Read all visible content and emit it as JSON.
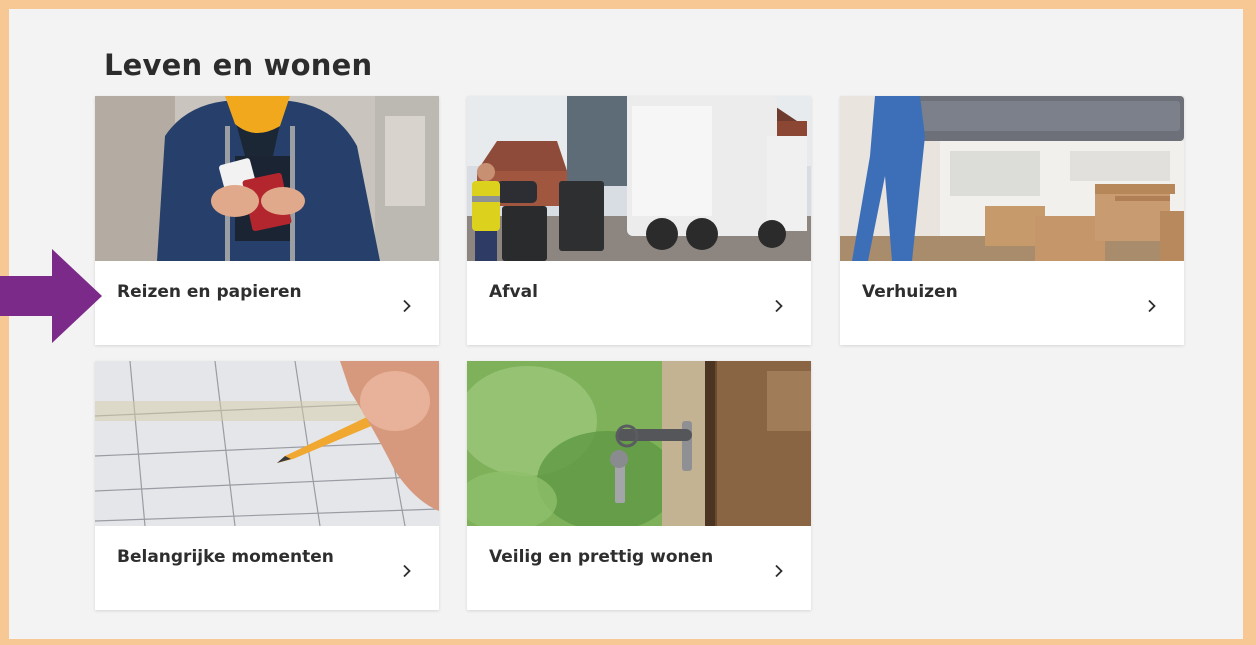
{
  "section": {
    "title": "Leven en wonen"
  },
  "cards": [
    {
      "label": "Reizen en papieren",
      "image": "traveler-with-passport-photo",
      "icon": "chevron-right-icon"
    },
    {
      "label": "Afval",
      "image": "garbage-truck-photo",
      "icon": "chevron-right-icon"
    },
    {
      "label": "Verhuizen",
      "image": "moving-boxes-photo",
      "icon": "chevron-right-icon"
    },
    {
      "label": "Belangrijke momenten",
      "image": "calendar-pencil-photo",
      "icon": "chevron-right-icon"
    },
    {
      "label": "Veilig en prettig wonen",
      "image": "key-in-door-photo",
      "icon": "chevron-right-icon"
    }
  ],
  "annotation": {
    "icon": "pointer-arrow-icon",
    "color": "#7b2a8a"
  },
  "colors": {
    "frame_border": "#f7c894",
    "background": "#f3f3f3",
    "card": "#ffffff",
    "text": "#2c2c2c"
  }
}
